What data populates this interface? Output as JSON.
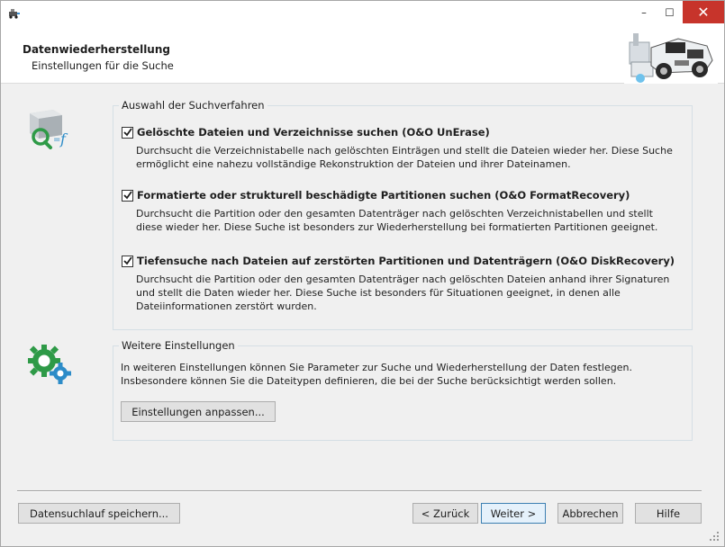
{
  "window": {
    "minimize_symbol": "–",
    "maximize_symbol": "☐",
    "close_symbol": "✕",
    "app_icon": "recovery-app-icon"
  },
  "header": {
    "title": "Datenwiederherstellung",
    "subtitle": "Einstellungen für die Suche",
    "logo": "recovery-vehicle-logo"
  },
  "search_methods": {
    "legend": "Auswahl der Suchverfahren",
    "icon": "search-file-icon",
    "options": [
      {
        "checked": true,
        "label": "Gelöschte Dateien und Verzeichnisse suchen (O&O UnErase)",
        "description": "Durchsucht die Verzeichnistabelle nach gelöschten Einträgen und stellt die Dateien wieder her. Diese Suche ermöglicht eine nahezu vollständige Rekonstruktion der Dateien und ihrer Dateinamen."
      },
      {
        "checked": true,
        "label": "Formatierte oder strukturell beschädigte Partitionen suchen (O&O FormatRecovery)",
        "description": "Durchsucht die Partition oder den gesamten Datenträger nach gelöschten Verzeichnistabellen und stellt diese wieder her. Diese Suche ist besonders zur Wiederherstellung bei formatierten Partitionen geeignet."
      },
      {
        "checked": true,
        "label": "Tiefensuche nach Dateien auf zerstörten Partitionen und Datenträgern (O&O DiskRecovery)",
        "description": "Durchsucht die Partition oder den gesamten Datenträger nach gelöschten Dateien anhand ihrer Signaturen und stellt die Daten wieder her. Diese Suche ist besonders für Situationen geeignet, in denen alle Dateiinformationen zerstört wurden."
      }
    ]
  },
  "further_settings": {
    "legend": "Weitere Einstellungen",
    "icon": "gear-settings-icon",
    "text": "In weiteren Einstellungen können Sie Parameter zur Suche und Wiederherstellung der Daten festlegen. Insbesondere können Sie die Dateitypen definieren, die bei der Suche berücksichtigt werden sollen.",
    "button": "Einstellungen anpassen..."
  },
  "footer": {
    "save_button": "Datensuchlauf speichern...",
    "back_button": "< Zurück",
    "next_button": "Weiter >",
    "cancel_button": "Abbrechen",
    "help_button": "Hilfe"
  },
  "colors": {
    "close_red": "#c7342b",
    "accent_blue": "#3c7fb1",
    "icon_green": "#2e9a47",
    "icon_blue": "#2d8cc8"
  }
}
